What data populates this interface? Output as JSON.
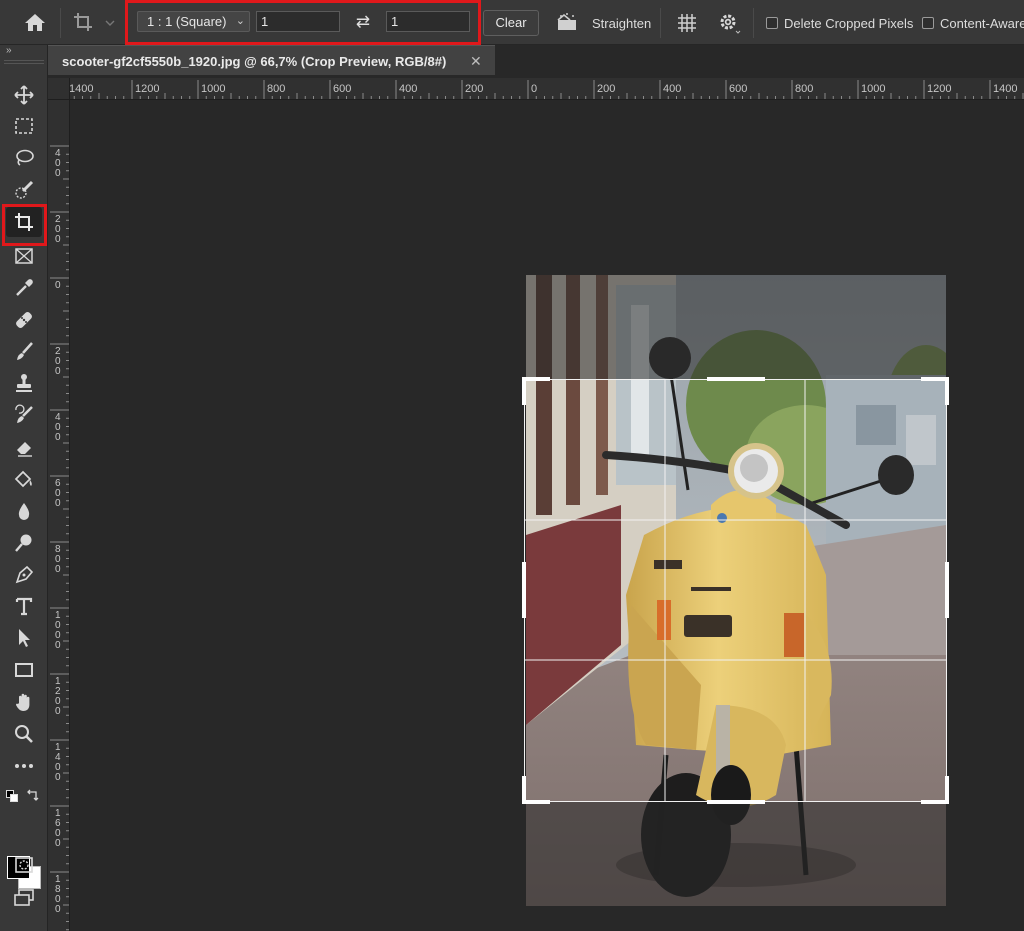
{
  "options_bar": {
    "aspect_preset": "1 : 1 (Square)",
    "width_value": "1",
    "height_value": "1",
    "clear_label": "Clear",
    "straighten_label": "Straighten",
    "delete_cropped_label": "Delete Cropped Pixels",
    "content_aware_label": "Content-Aware",
    "delete_cropped_checked": false,
    "content_aware_checked": false
  },
  "document": {
    "tab_title": "scooter-gf2cf5550b_1920.jpg @ 66,7% (Crop Preview, RGB/8#)",
    "close_glyph": "✕"
  },
  "toolbar": {
    "collapse_glyph": "»",
    "tools": [
      "move-tool",
      "marquee-tool",
      "lasso-tool",
      "quick-select-tool",
      "crop-tool",
      "frame-tool",
      "eyedropper-tool",
      "healing-tool",
      "brush-tool",
      "clone-stamp-tool",
      "history-brush-tool",
      "eraser-tool",
      "paint-bucket-tool",
      "blur-tool",
      "dodge-tool",
      "pen-tool",
      "type-tool",
      "path-select-tool",
      "rectangle-tool",
      "hand-tool",
      "zoom-tool",
      "more-tools",
      "default-colors",
      "swap-colors"
    ],
    "active_tool": "crop-tool",
    "foreground_color": "#000000",
    "background_color": "#ffffff"
  },
  "rulers": {
    "top_labels": [
      "1400",
      "1200",
      "1000",
      "800",
      "600",
      "400",
      "200",
      "0",
      "200",
      "400",
      "600",
      "800",
      "1000",
      "1200",
      "1400"
    ],
    "left_labels": [
      "400",
      "200",
      "0",
      "200",
      "400",
      "600",
      "800",
      "1000",
      "1200",
      "1400",
      "1600",
      "1800"
    ]
  },
  "colors": {
    "highlight": "#e0181b",
    "panel_bg": "#383838",
    "canvas_bg": "#282828",
    "scooter_yellow": "#e8c768"
  }
}
